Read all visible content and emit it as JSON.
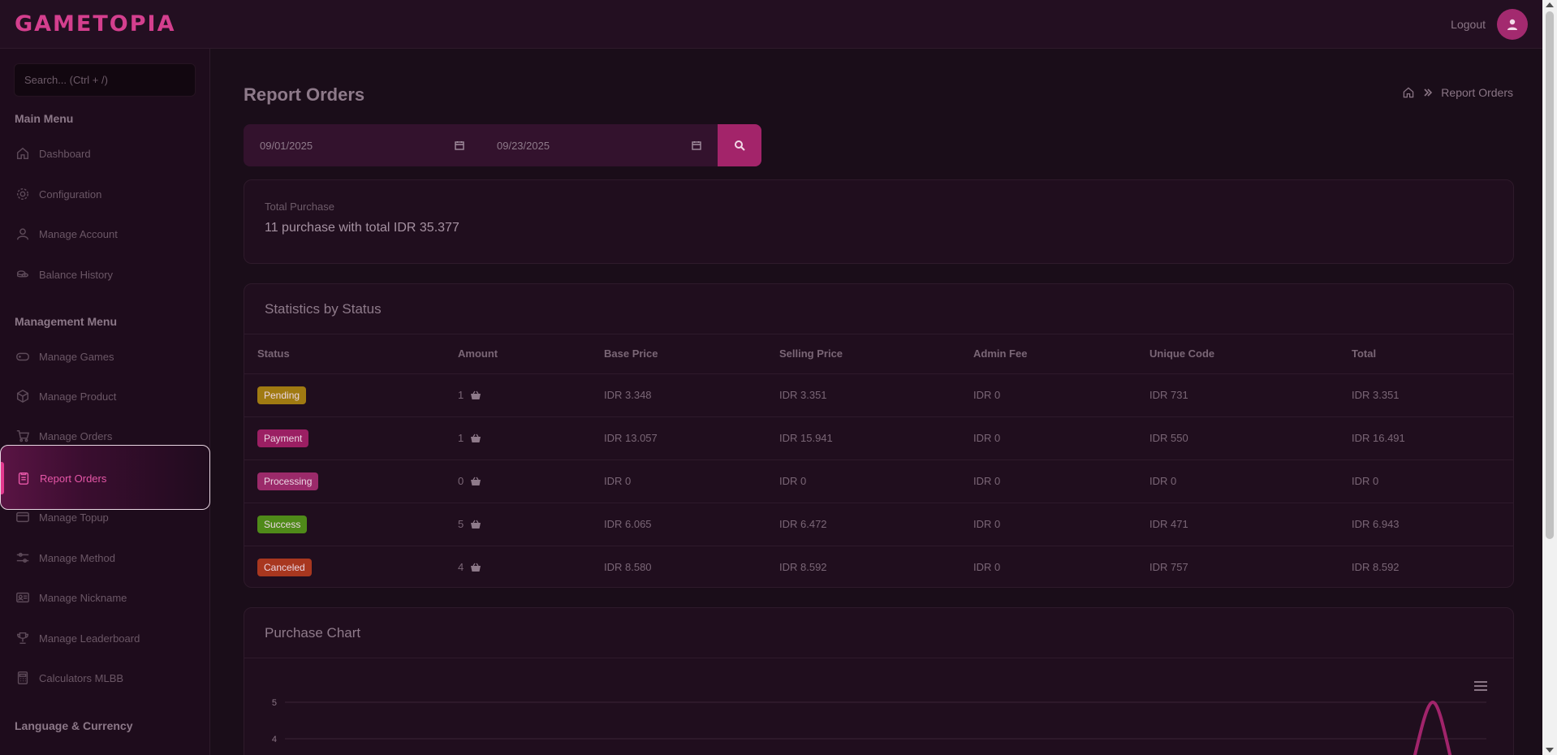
{
  "header": {
    "brand": "GAMETOPIA",
    "logout_label": "Logout"
  },
  "sidebar": {
    "search_placeholder": "Search... (Ctrl + /)",
    "main_menu_title": "Main Menu",
    "main_items": [
      {
        "label": "Dashboard",
        "icon": "home-icon"
      },
      {
        "label": "Configuration",
        "icon": "gear-icon"
      },
      {
        "label": "Manage Account",
        "icon": "user-icon"
      },
      {
        "label": "Balance History",
        "icon": "coins-icon"
      }
    ],
    "management_menu_title": "Management Menu",
    "management_items": [
      {
        "label": "Manage Games",
        "icon": "gamepad-icon"
      },
      {
        "label": "Manage Product",
        "icon": "box-icon"
      },
      {
        "label": "Manage Orders",
        "icon": "cart-icon"
      },
      {
        "label": "Report Orders",
        "icon": "clipboard-icon",
        "active": true
      },
      {
        "label": "Manage Topup",
        "icon": "wallet-icon"
      },
      {
        "label": "Manage Method",
        "icon": "sliders-icon"
      },
      {
        "label": "Manage Nickname",
        "icon": "id-card-icon"
      },
      {
        "label": "Manage Leaderboard",
        "icon": "trophy-icon"
      },
      {
        "label": "Calculators MLBB",
        "icon": "calculator-icon"
      }
    ],
    "language_title": "Language & Currency"
  },
  "page": {
    "title": "Report Orders",
    "breadcrumb_current": "Report Orders"
  },
  "filter": {
    "start_date": "09/01/2025",
    "end_date": "09/23/2025"
  },
  "summary": {
    "label": "Total Purchase",
    "value": "11 purchase with total IDR 35.377"
  },
  "stats": {
    "title": "Statistics by Status",
    "columns": [
      "Status",
      "Amount",
      "Base Price",
      "Selling Price",
      "Admin Fee",
      "Unique Code",
      "Total"
    ],
    "rows": [
      {
        "status": "Pending",
        "color": "#a07a12",
        "amount": "1",
        "base": "IDR 3.348",
        "selling": "IDR 3.351",
        "admin": "IDR 0",
        "unique": "IDR 731",
        "total": "IDR 3.351"
      },
      {
        "status": "Payment",
        "color": "#9b1f63",
        "amount": "1",
        "base": "IDR 13.057",
        "selling": "IDR 15.941",
        "admin": "IDR 0",
        "unique": "IDR 550",
        "total": "IDR 16.491"
      },
      {
        "status": "Processing",
        "color": "#9b2a6a",
        "amount": "0",
        "base": "IDR 0",
        "selling": "IDR 0",
        "admin": "IDR 0",
        "unique": "IDR 0",
        "total": "IDR 0"
      },
      {
        "status": "Success",
        "color": "#4f8a19",
        "amount": "5",
        "base": "IDR 6.065",
        "selling": "IDR 6.472",
        "admin": "IDR 0",
        "unique": "IDR 471",
        "total": "IDR 6.943"
      },
      {
        "status": "Canceled",
        "color": "#a8371f",
        "amount": "4",
        "base": "IDR 8.580",
        "selling": "IDR 8.592",
        "admin": "IDR 0",
        "unique": "IDR 757",
        "total": "IDR 8.592"
      }
    ]
  },
  "chart": {
    "title": "Purchase Chart",
    "y_ticks": [
      "5",
      "4"
    ]
  },
  "chart_data": {
    "type": "line",
    "title": "Purchase Chart",
    "yticks": [
      5,
      4
    ],
    "visible_peak": 5
  }
}
